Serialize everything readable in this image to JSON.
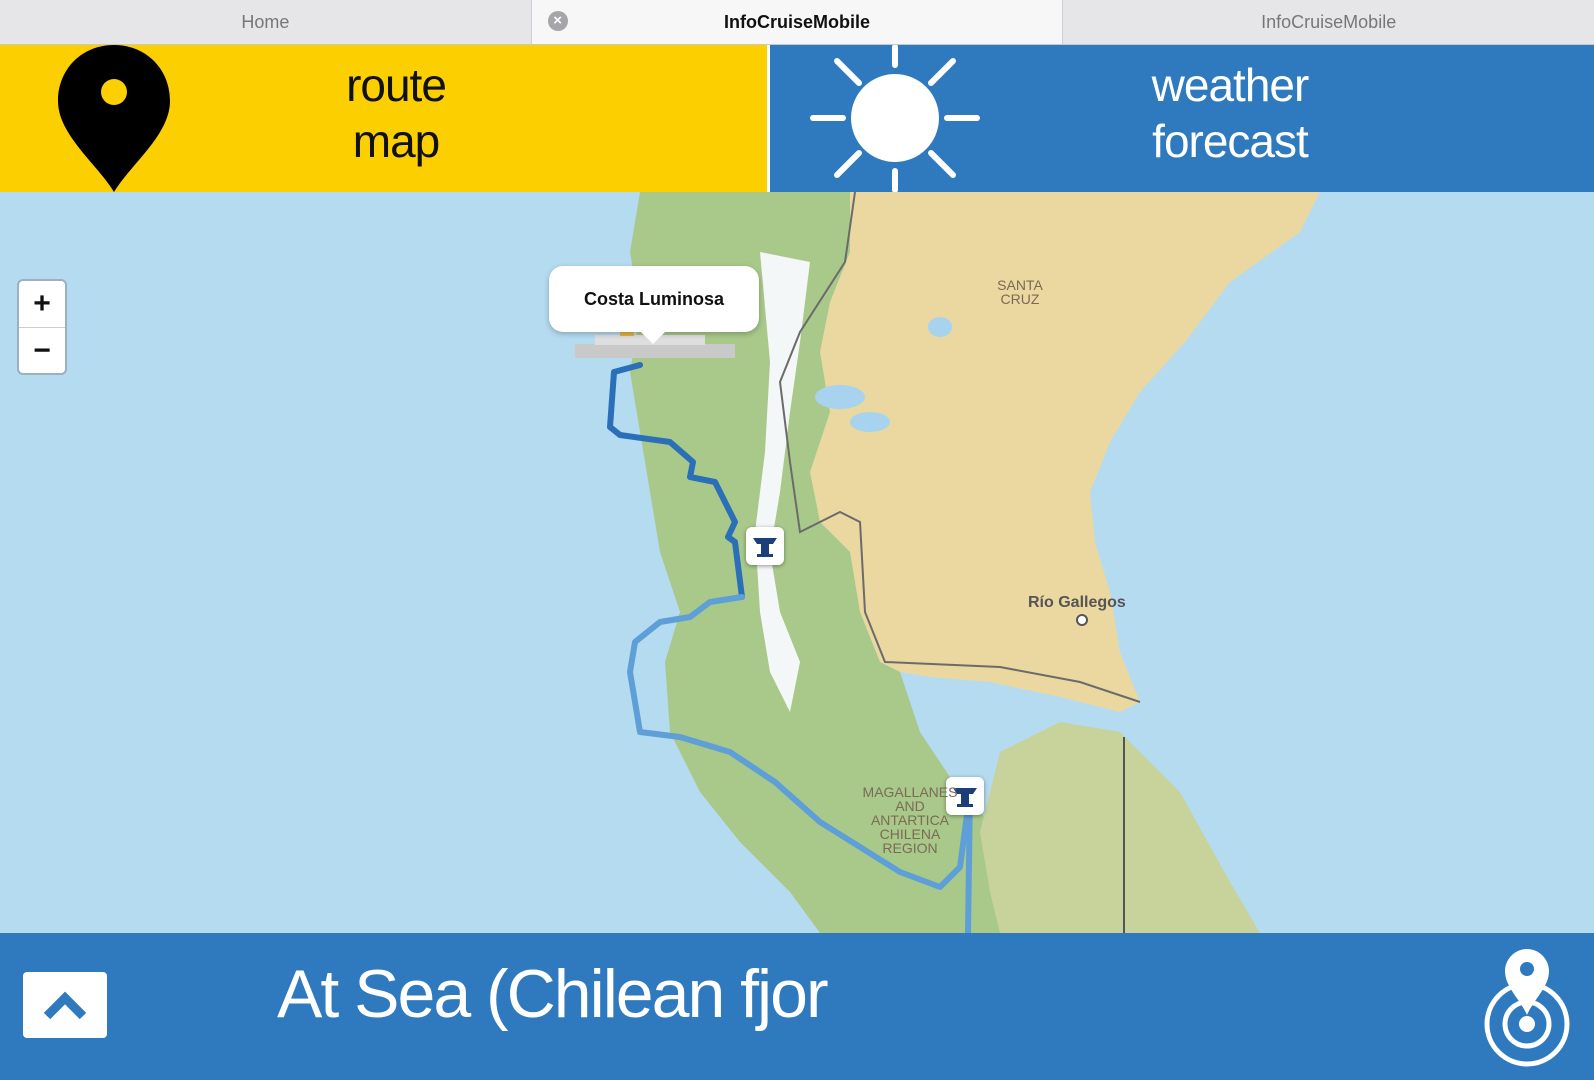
{
  "tabs": [
    {
      "label": "Home"
    },
    {
      "label": "InfoCruiseMobile",
      "close_glyph": "×"
    },
    {
      "label": "InfoCruiseMobile"
    }
  ],
  "header": {
    "route_tile": {
      "label_line1": "route",
      "label_line2": "map",
      "icon": "map-pin-icon",
      "color": "#fccf00"
    },
    "weather_tile": {
      "label_line1": "weather",
      "label_line2": "forecast",
      "icon": "sun-icon",
      "color": "#2f79bf"
    }
  },
  "map": {
    "zoom_in": "+",
    "zoom_out": "−",
    "ship_popup": "Costa Luminosa",
    "labels": {
      "santa_cruz_1": "SANTA",
      "santa_cruz_2": "CRUZ",
      "rio_gallegos": "Río Gallegos",
      "magallanes_1": "MAGALLANES",
      "magallanes_2": "AND",
      "magallanes_3": "ANTARTICA",
      "magallanes_4": "CHILENA",
      "magallanes_5": "REGION"
    },
    "port_markers": [
      "anchor-port-icon",
      "anchor-port-icon"
    ]
  },
  "bottom": {
    "status": "At Sea (Chilean fjor",
    "up_icon": "chevron-up-icon",
    "locate_icon": "locate-pin-icon"
  }
}
